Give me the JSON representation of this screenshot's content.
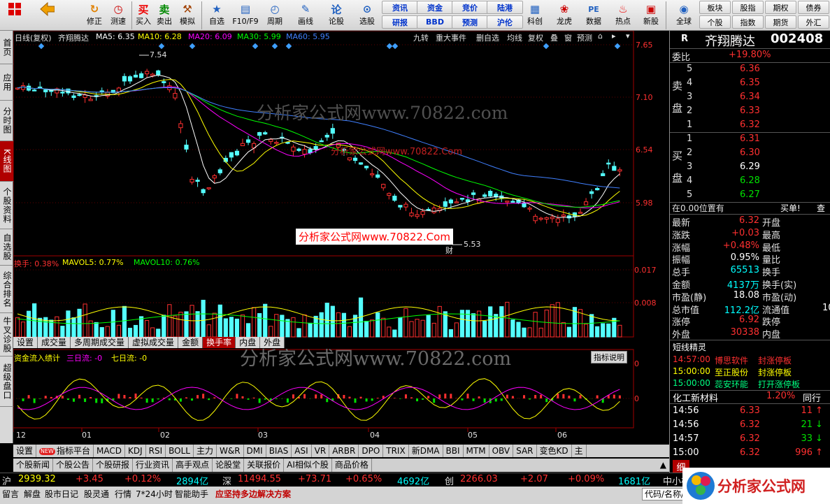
{
  "toolbar": {
    "items": [
      "修正",
      "测速",
      "买入",
      "卖出",
      "模拟",
      "自选",
      "F10/F9",
      "周期",
      "画线",
      "论股",
      "选股"
    ],
    "grid_top": [
      "资讯",
      "资金",
      "竞价",
      "陆港",
      "",
      "",
      "",
      "",
      "",
      "",
      "",
      "板块",
      "股指",
      "期权",
      "债券"
    ],
    "grid_bottom": [
      "研报",
      "BBD",
      "预测",
      "沪伦",
      "科创",
      "龙虎",
      "数据",
      "热点",
      "新股",
      "全球",
      "个股",
      "指数",
      "期货",
      "外汇"
    ]
  },
  "left_nav": [
    "首页",
    "应用",
    "分时图",
    "K线图",
    "个股资料",
    "自选股",
    "综合排名",
    "牛叉诊股",
    "超级盘口"
  ],
  "chart": {
    "title": "日线(复权)",
    "stock": "齐翔腾达",
    "ma": [
      {
        "label": "MA5: 6.35",
        "color": "#ffffff"
      },
      {
        "label": "MA10: 6.28",
        "color": "#ffff00"
      },
      {
        "label": "MA20: 6.09",
        "color": "#ff00ff"
      },
      {
        "label": "MA30: 5.99",
        "color": "#00ff00"
      },
      {
        "label": "MA60: 5.95",
        "color": "#4080ff"
      }
    ],
    "buttons": [
      "九转",
      "重大事件",
      "删自选",
      "均线",
      "复权",
      "叠",
      "窗",
      "预测"
    ],
    "price_axis": [
      "7.65",
      "7.10",
      "6.54",
      "5.98"
    ],
    "high_label": "7.54",
    "low_label": "5.53",
    "cai": "财",
    "vol_title": "换手: 0.38%",
    "vol_mav5": "MAVOL5: 0.77%",
    "vol_mav10": "MAVOL10: 0.76%",
    "vol_axis": [
      "0.017",
      "0.008"
    ],
    "vol_tabs": [
      "设置",
      "成交量",
      "多周期成交量",
      "虚拟成交量",
      "金额",
      "换手率",
      "内盘",
      "外盘"
    ],
    "ind_title": "资金流入绩计",
    "ind_3": "三日流: -0",
    "ind_7": "七日流: -0",
    "ind_btn": "指标说明",
    "ind_axis": [
      "0",
      "0"
    ],
    "months": [
      "12",
      "01",
      "02",
      "03",
      "04",
      "05",
      "06"
    ]
  },
  "watermarks": {
    "w1": "分析家公式网www.70822.com",
    "w2": "分析家公式网www.70822.Com",
    "w3": "分析家公式网www.70822.Com",
    "w4": "分析家公式网www.70822.com"
  },
  "bottom_tabs": [
    "设置",
    "NEW",
    "指标平台",
    "MACD",
    "KDJ",
    "RSI",
    "BOLL",
    "主力",
    "W&R",
    "DMI",
    "BIAS",
    "ASI",
    "VR",
    "ARBR",
    "DPO",
    "TRIX",
    "新DMA",
    "BBI",
    "MTM",
    "OBV",
    "SAR",
    "变色KD",
    "主"
  ],
  "news_tabs": [
    "个股新闻",
    "个股公告",
    "个股研报",
    "行业资讯",
    "高手观点",
    "论股堂",
    "关联报价",
    "AI相似个股",
    "商品价格"
  ],
  "right": {
    "r": "R",
    "name": "齐翔腾达",
    "code": "002408",
    "weibi_label": "委比",
    "weibi": "+19.80%",
    "sell_label": [
      "卖",
      "盘"
    ],
    "buy_label": [
      "买",
      "盘"
    ],
    "sells": [
      [
        "5",
        "6.36"
      ],
      [
        "4",
        "6.35"
      ],
      [
        "3",
        "6.34"
      ],
      [
        "2",
        "6.33"
      ],
      [
        "1",
        "6.32"
      ]
    ],
    "buys": [
      [
        "1",
        "6.31"
      ],
      [
        "2",
        "6.30"
      ],
      [
        "3",
        "6.29"
      ],
      [
        "4",
        "6.28"
      ],
      [
        "5",
        "6.27"
      ]
    ],
    "pos": "在0.00位置有",
    "buy_single": "买单!",
    "cha": "查",
    "rows": [
      [
        "最新",
        "6.32",
        "开盘",
        ""
      ],
      [
        "涨跌",
        "+0.03",
        "最高",
        ""
      ],
      [
        "涨幅",
        "+0.48%",
        "最低",
        ""
      ],
      [
        "振幅",
        "0.95%",
        "量比",
        ""
      ],
      [
        "总手",
        "65513",
        "换手",
        ""
      ],
      [
        "金额",
        "4137万",
        "换手(实)",
        ""
      ],
      [
        "市盈(静)",
        "18.08",
        "市盈(动)",
        ""
      ],
      [
        "总市值",
        "112.2亿",
        "流通值",
        "10"
      ],
      [
        "涨停",
        "6.92",
        "跌停",
        ""
      ],
      [
        "外盘",
        "30338",
        "内盘",
        ""
      ]
    ],
    "jl_title": "短线精灵",
    "jl": [
      [
        "14:57:00",
        "博思软件",
        "封涨停板"
      ],
      [
        "15:00:00",
        "至正股份",
        "封涨停板"
      ],
      [
        "15:00:00",
        "蕊安环能",
        "打开涨停板"
      ]
    ],
    "industry": "化工新材料",
    "industry_pct": "1.20%",
    "tongxing": "同行",
    "ticks": [
      [
        "14:56",
        "6.33",
        "11",
        "up"
      ],
      [
        "14:56",
        "6.32",
        "21",
        "down"
      ],
      [
        "14:57",
        "6.32",
        "33",
        "down"
      ],
      [
        "15:00",
        "6.32",
        "996",
        "up"
      ]
    ],
    "tab": "细"
  },
  "status": {
    "sh_label": "沪",
    "sh": "2939.32",
    "sh_chg": "+3.45",
    "sh_pct": "+0.12%",
    "sh_amt": "2894亿",
    "sz_label": "深",
    "sz": "11494.55",
    "sz_chg": "+73.71",
    "sz_pct": "+0.65%",
    "sz_amt": "4692亿",
    "cy_label": "创",
    "cy": "2266.03",
    "cy_chg": "+2.07",
    "cy_pct": "+0.09%",
    "cy_amt": "1681亿",
    "zx": "中小板"
  },
  "bottom": {
    "items": [
      "留言",
      "解盘",
      "股市日记",
      "股灵通",
      "行情",
      "7*24小时",
      "智能助手"
    ],
    "promo": "应坚持多边解决方案",
    "code": "代码/名称/"
  },
  "logo": "分析家公式网"
}
